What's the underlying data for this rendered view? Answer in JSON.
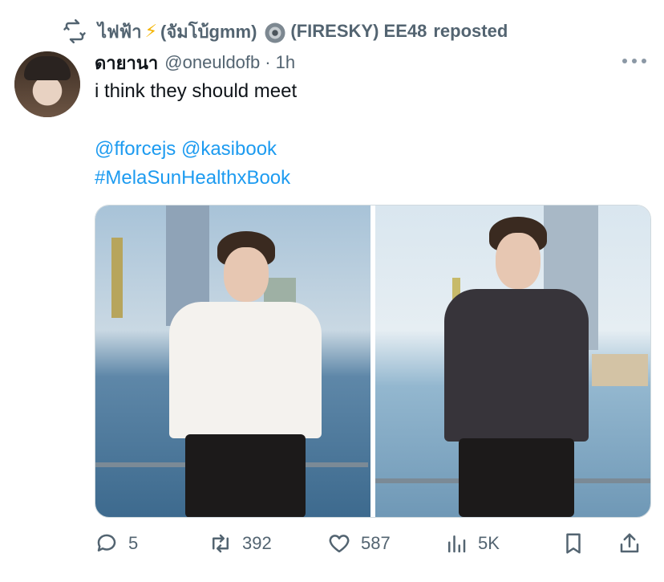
{
  "repost": {
    "name_part1": "ไฟฟ้า",
    "bolt": "⚡",
    "name_part2": "(จัมโบ้gmm)",
    "name_part3": "(FIRESKY) EE48",
    "suffix": "reposted"
  },
  "tweet": {
    "author_name": "ดายานา",
    "handle": "@oneuldofb",
    "separator": "·",
    "time": "1h",
    "text": "i think they should meet",
    "mentions": "@fforcejs @kasibook",
    "hashtag": "#MelaSunHealthxBook"
  },
  "actions": {
    "replies": "5",
    "reposts": "392",
    "likes": "587",
    "views": "5K"
  },
  "colors": {
    "link": "#1d9bf0",
    "secondary": "#536471",
    "text": "#0f1419"
  },
  "icons": [
    "repost-icon",
    "gear-badge-icon",
    "more-icon",
    "reply-icon",
    "retweet-icon",
    "like-icon",
    "views-icon",
    "bookmark-icon",
    "share-icon"
  ]
}
